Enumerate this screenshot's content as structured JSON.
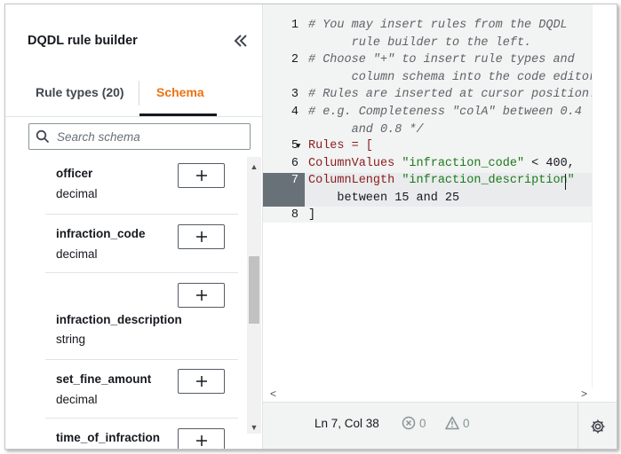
{
  "panel": {
    "title": "DQDL rule builder",
    "collapse_icon": "double-chevron-left-icon"
  },
  "tabs": [
    {
      "label": "Rule types (20)"
    },
    {
      "label": "Schema",
      "active": true
    }
  ],
  "colors": {
    "accent": "#ec7211",
    "line_highlight": "#687078"
  },
  "search": {
    "placeholder": "Search schema"
  },
  "schema": [
    {
      "name": "officer",
      "type": "decimal"
    },
    {
      "name": "infraction_code",
      "type": "decimal"
    },
    {
      "name": "infraction_description",
      "type": "string"
    },
    {
      "name": "set_fine_amount",
      "type": "decimal"
    },
    {
      "name": "time_of_infraction",
      "type": ""
    }
  ],
  "editor": {
    "line_numbers": [
      "1",
      "2",
      "3",
      "4",
      "5",
      "6",
      "7",
      "8"
    ],
    "lines": [
      [
        "# You may insert rules from the DQDL",
        "      rule builder to the left."
      ],
      [
        "# Choose \"+\" to insert rule types and",
        "      column schema into the code editor."
      ],
      [
        "# Rules are inserted at cursor position."
      ],
      [
        "# e.g. Completeness \"colA\" between 0.4",
        "      and 0.8 */"
      ],
      [
        "Rules = ["
      ],
      [
        "ColumnValues ",
        "\"infraction_code\"",
        " < 400,"
      ],
      [
        "ColumnLength ",
        "\"infraction_description\"",
        "    between 15 and 25"
      ],
      [
        "]"
      ]
    ]
  },
  "status": {
    "position": "Ln 7, Col 38",
    "errors": "0",
    "warnings": "0"
  }
}
